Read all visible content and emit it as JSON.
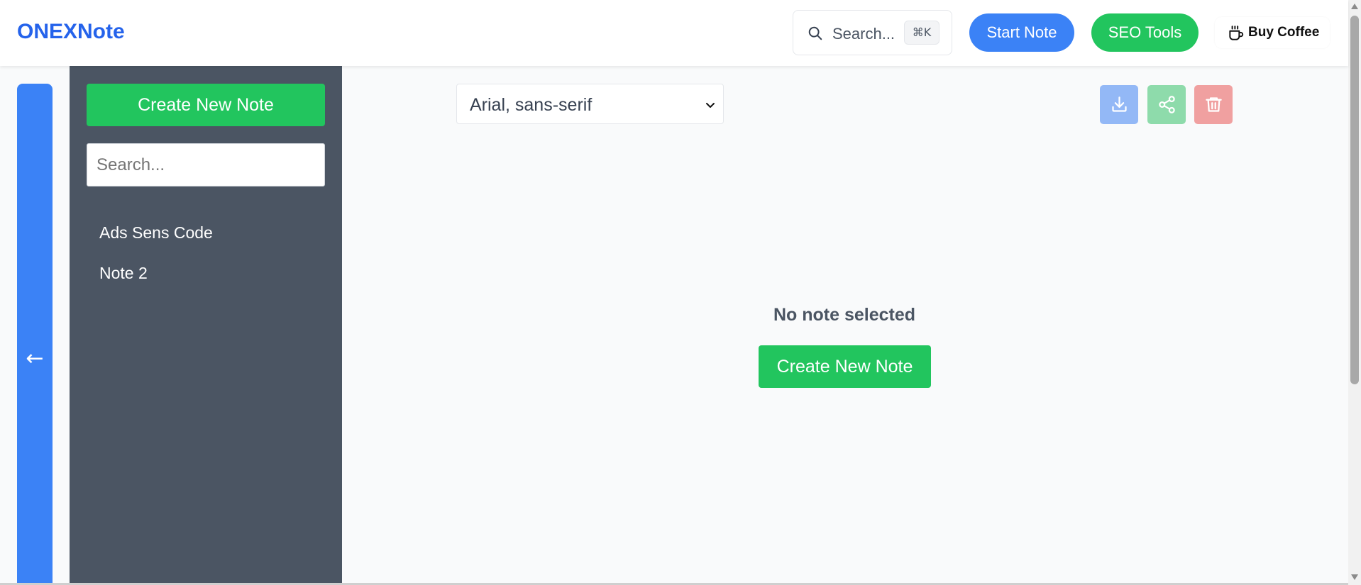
{
  "header": {
    "brand": "ONEXNote",
    "search_label": "Search...",
    "search_shortcut": "⌘K",
    "start_note_label": "Start Note",
    "seo_tools_label": "SEO Tools",
    "buy_coffee_label": "Buy Coffee"
  },
  "collapse": {
    "arrow": "←"
  },
  "sidebar": {
    "create_label": "Create New Note",
    "search_placeholder": "Search...",
    "notes": [
      {
        "title": "Ads Sens Code"
      },
      {
        "title": "Note 2"
      }
    ]
  },
  "editor": {
    "font_value": "Arial, sans-serif",
    "empty_title": "No note selected",
    "empty_create_label": "Create New Note"
  },
  "icons": {
    "search": "search-icon",
    "coffee": "coffee-cup-icon",
    "download": "download-icon",
    "share": "share-icon",
    "delete": "trash-icon",
    "select": "chevron-down-icon"
  },
  "colors": {
    "brand": "#2563eb",
    "primary": "#3b82f6",
    "success": "#22c55e",
    "sidebar_bg": "#4b5563",
    "danger_soft": "#f0a0a0"
  }
}
